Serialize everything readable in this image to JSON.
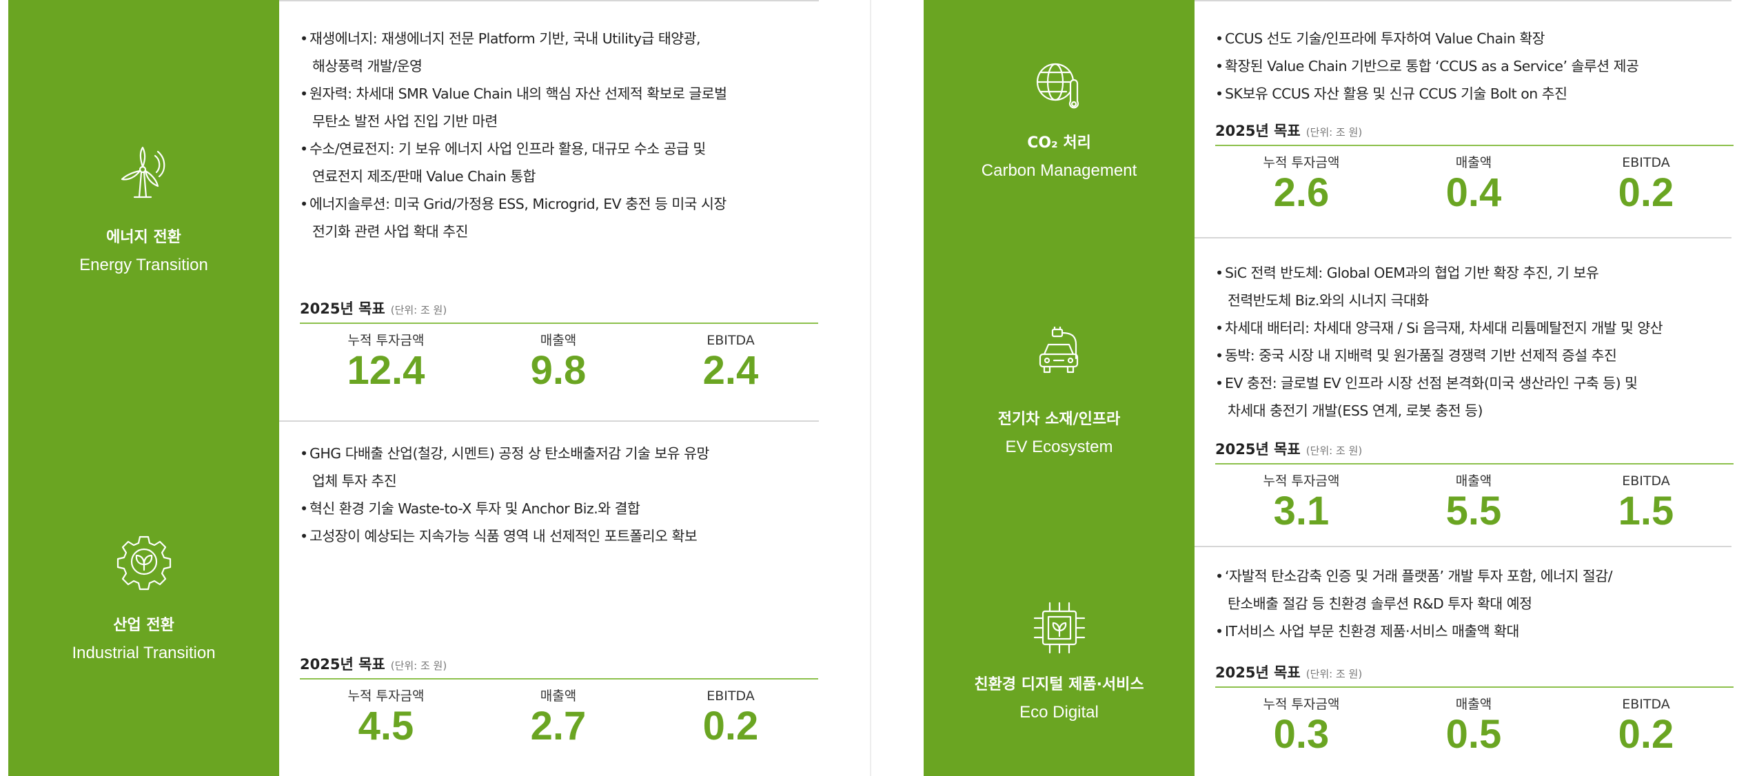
{
  "goal_title": "2025년 목표",
  "goal_unit": "(단위: 조 원)",
  "metric_labels": [
    "누적 투자금액",
    "매출액",
    "EBITDA"
  ],
  "sections": [
    {
      "title_ko": "에너지 전환",
      "title_en": "Energy Transition",
      "icon": "wind-turbine-icon",
      "bullets": [
        "재생에너지: 재생에너지 전문 Platform 기반, 국내 Utility급 태양광,",
        "해상풍력 개발/운영",
        "원자력: 차세대 SMR Value Chain 내의 핵심 자산 선제적 확보로 글로벌",
        "무탄소 발전 사업 진입 기반 마련",
        "수소/연료전지: 기 보유 에너지 사업 인프라 활용, 대규모 수소 공급 및",
        "연료전지 제조/판매 Value Chain 통합",
        "에너지솔루션: 미국 Grid/가정용 ESS, Microgrid, EV 충전 등 미국 시장",
        "전기화 관련 사업 확대 추진"
      ],
      "values": [
        "12.4",
        "9.8",
        "2.4"
      ]
    },
    {
      "title_ko": "산업 전환",
      "title_en": "Industrial Transition",
      "icon": "gear-leaf-icon",
      "bullets": [
        "GHG 다배출 산업(철강, 시멘트) 공정 상 탄소배출저감 기술 보유 유망",
        "업체 투자 추진",
        "혁신 환경 기술 Waste-to-X 투자 및 Anchor Biz.와 결합",
        "고성장이 예상되는 지속가능 식품 영역 내 선제적인 포트폴리오 확보"
      ],
      "values": [
        "4.5",
        "2.7",
        "0.2"
      ]
    },
    {
      "title_ko": "CO₂ 처리",
      "title_en": "Carbon Management",
      "icon": "globe-thermometer-icon",
      "bullets": [
        "CCUS 선도 기술/인프라에 투자하여 Value Chain 확장",
        "확장된 Value Chain 기반으로 통합 ‘CCUS as a Service’ 솔루션 제공",
        "SK보유 CCUS 자산 활용 및 신규 CCUS 기술 Bolt on 추진"
      ],
      "values": [
        "2.6",
        "0.4",
        "0.2"
      ]
    },
    {
      "title_ko": "전기차 소재/인프라",
      "title_en": "EV Ecosystem",
      "icon": "ev-charging-car-icon",
      "bullets": [
        "SiC 전력 반도체: Global OEM과의 협업 기반 확장 추진, 기 보유",
        "전력반도체 Biz.와의 시너지 극대화",
        "차세대 배터리: 차세대 양극재 / Si 음극재, 차세대 리튬메탈전지 개발 및 양산",
        "동박: 중국 시장 내 지배력 및 원가품질 경쟁력 기반 선제적 증설 추진",
        "EV 충전: 글로벌 EV 인프라 시장 선점 본격화(미국 생산라인 구축 등) 및",
        "차세대 충전기 개발(ESS 연계, 로봇 충전 등)"
      ],
      "values": [
        "3.1",
        "5.5",
        "1.5"
      ]
    },
    {
      "title_ko": "친환경 디지털 제품·서비스",
      "title_en": "Eco Digital",
      "icon": "chip-leaf-icon",
      "bullets": [
        "‘자발적 탄소감축 인증 및 거래 플랫폼’ 개발 투자 포함, 에너지 절감/",
        "탄소배출 절감 등 친환경 솔루션 R&D 투자 확대 예정",
        "IT서비스 사업 부문 친환경 제품·서비스 매출액 확대"
      ],
      "values": [
        "0.3",
        "0.5",
        "0.2"
      ]
    }
  ]
}
